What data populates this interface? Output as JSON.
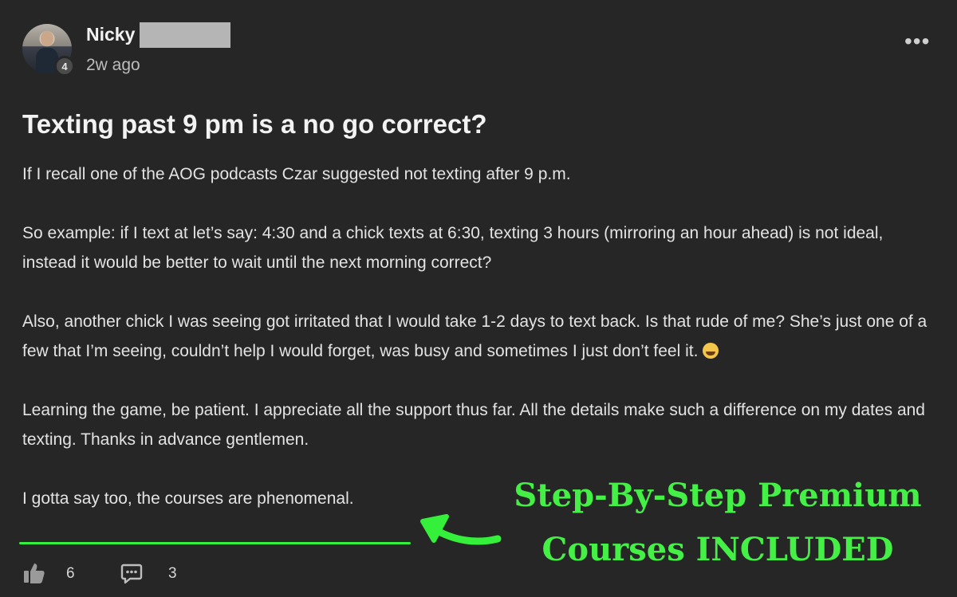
{
  "post": {
    "author": {
      "name": "Nicky",
      "level": "4",
      "time": "2w ago"
    },
    "more_menu": "•••",
    "title": "Texting past 9 pm is a no go correct?",
    "paragraphs": [
      "If I recall one of the AOG podcasts Czar suggested not texting after 9 p.m.",
      "So example: if I text at let’s say: 4:30 and a chick texts at 6:30, texting 3 hours (mirroring an hour ahead) is not ideal, instead it would be better to wait until the next morning correct?",
      "Also, another chick I was seeing got irritated that I would take 1-2 days to text back. Is that rude of me? She’s just one of a few that I’m seeing, couldn’t help I would forget, was busy and sometimes I just don’t feel it.",
      "Learning the game, be patient. I appreciate all the support thus far. All the details make such a difference on my dates and texting. Thanks in advance gentlemen.",
      "I gotta say too, the courses are phenomenal."
    ],
    "emoji": "grinning-sweat-emoji",
    "likes": "6",
    "comments": "3"
  },
  "annotation": {
    "line1": "Step-By-Step Premium",
    "line2": "Courses INCLUDED",
    "color": "#45f046"
  },
  "colors": {
    "background": "#262626",
    "text": "#e3e3e3",
    "accent_green": "#35f03a"
  }
}
